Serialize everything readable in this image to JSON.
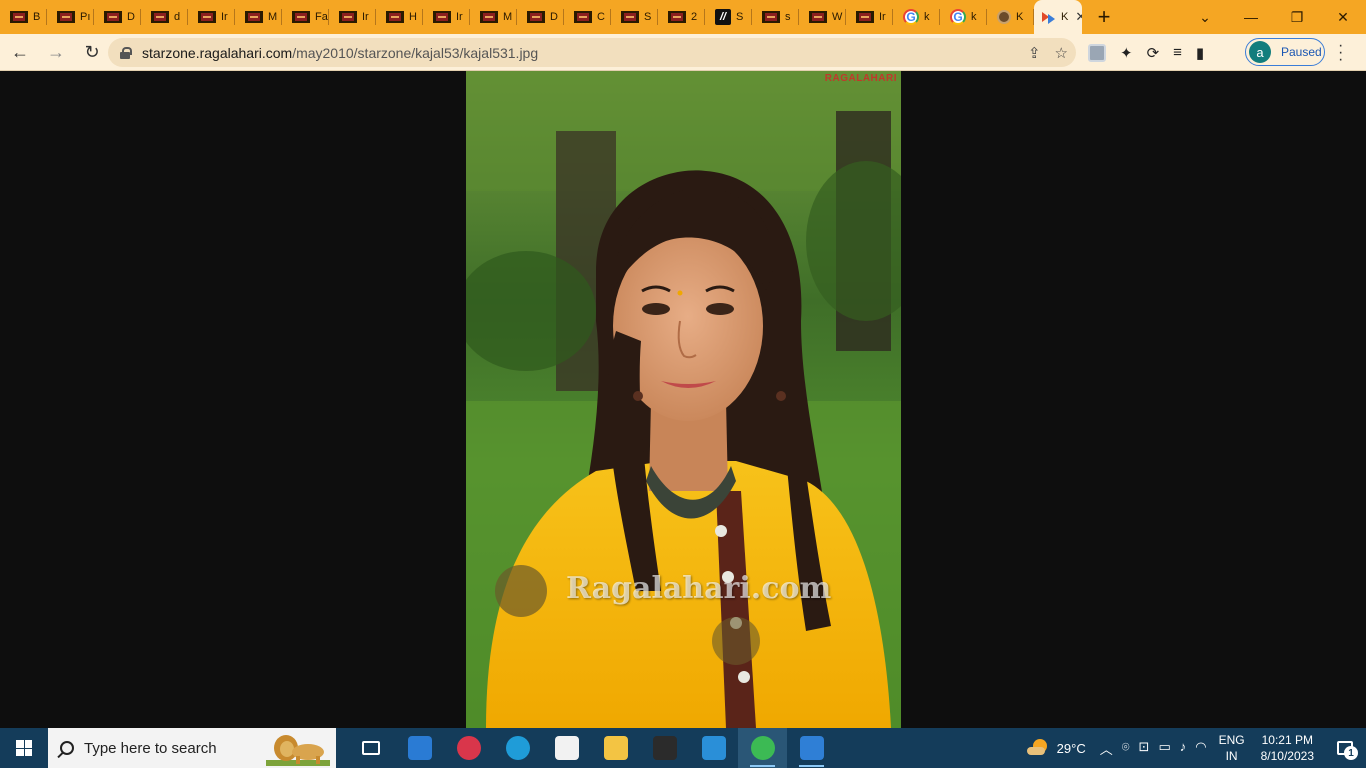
{
  "browser": {
    "tabs": [
      {
        "label": "B",
        "favicon": "film-icon"
      },
      {
        "label": "Pı",
        "favicon": "film-icon"
      },
      {
        "label": "D",
        "favicon": "film-icon"
      },
      {
        "label": "d",
        "favicon": "film-icon"
      },
      {
        "label": "Ir",
        "favicon": "film-icon"
      },
      {
        "label": "M",
        "favicon": "film-icon"
      },
      {
        "label": "Fa",
        "favicon": "film-icon"
      },
      {
        "label": "Ir",
        "favicon": "film-icon"
      },
      {
        "label": "H",
        "favicon": "film-icon"
      },
      {
        "label": "Ir",
        "favicon": "film-icon"
      },
      {
        "label": "M",
        "favicon": "film-icon"
      },
      {
        "label": "D",
        "favicon": "film-icon"
      },
      {
        "label": "C",
        "favicon": "film-icon"
      },
      {
        "label": "S",
        "favicon": "film-icon"
      },
      {
        "label": "2",
        "favicon": "film-icon"
      },
      {
        "label": "S",
        "favicon": "slash-icon"
      },
      {
        "label": "s",
        "favicon": "film-icon"
      },
      {
        "label": "W",
        "favicon": "film-icon"
      },
      {
        "label": "Ir",
        "favicon": "film-icon"
      },
      {
        "label": "k",
        "favicon": "google-icon"
      },
      {
        "label": "k",
        "favicon": "google-icon"
      },
      {
        "label": "K",
        "favicon": "dot-icon"
      }
    ],
    "active_tab": {
      "label": "K",
      "favicon": "ragalahari-icon"
    },
    "new_tab_glyph": "+",
    "window_controls": {
      "dropdown": "⌄",
      "minimize": "—",
      "restore": "❐",
      "close": "✕"
    },
    "nav": {
      "back": "←",
      "forward": "→",
      "reload": "↻"
    },
    "url": {
      "host": "starzone.ragalahari.com",
      "path": "/may2010/starzone/kajal53/kajal531.jpg"
    },
    "profile": {
      "initial": "a",
      "status": "Paused"
    },
    "colors": {
      "frame": "#f5a623",
      "toolbar": "#fdf0d9",
      "accent": "#1a56b3"
    }
  },
  "content": {
    "watermark_top": "RAGALAHARI",
    "watermark_center": "Ragalahari.com"
  },
  "taskbar": {
    "search_placeholder": "Type here to search",
    "apps": [
      {
        "name": "task-view"
      },
      {
        "name": "mail"
      },
      {
        "name": "wps-office"
      },
      {
        "name": "edge"
      },
      {
        "name": "microsoft-store"
      },
      {
        "name": "file-explorer"
      },
      {
        "name": "terminal"
      },
      {
        "name": "vs-code"
      },
      {
        "name": "chrome",
        "active": true
      },
      {
        "name": "photos"
      }
    ],
    "weather": {
      "temp": "29°C"
    },
    "language": {
      "line1": "ENG",
      "line2": "IN"
    },
    "clock": {
      "time": "10:21 PM",
      "date": "8/10/2023"
    },
    "notifications": {
      "count": "1"
    }
  }
}
